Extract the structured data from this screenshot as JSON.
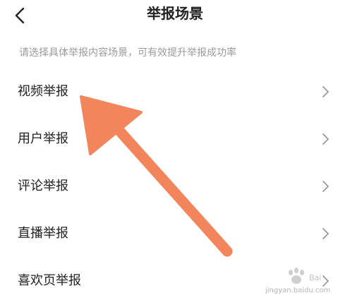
{
  "header": {
    "title": "举报场景",
    "back_icon": "chevron-left-icon"
  },
  "hint": "请选择具体举报内容场景，可有效提升举报成功率",
  "items": [
    {
      "label": "视频举报",
      "icon": "chevron-right-icon"
    },
    {
      "label": "用户举报",
      "icon": "chevron-right-icon"
    },
    {
      "label": "评论举报",
      "icon": "chevron-right-icon"
    },
    {
      "label": "直播举报",
      "icon": "chevron-right-icon"
    },
    {
      "label": "喜欢页举报",
      "icon": "chevron-right-icon"
    }
  ],
  "annotation": {
    "type": "arrow",
    "color": "#f2855c"
  },
  "watermark": {
    "text": "jingyan.baidu.com",
    "logo": "baidu-paw-logo"
  }
}
